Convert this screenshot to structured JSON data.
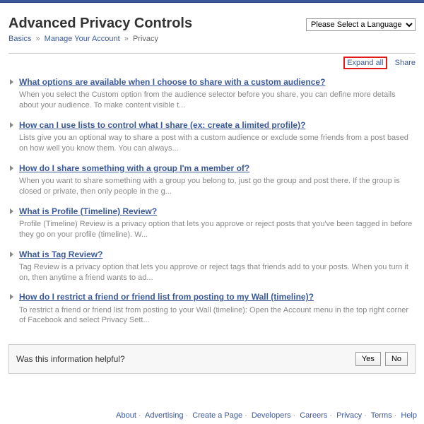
{
  "title": "Advanced Privacy Controls",
  "breadcrumb": {
    "basics": "Basics",
    "manage": "Manage Your Account",
    "current": "Privacy"
  },
  "lang_select": {
    "placeholder": "Please Select a Language"
  },
  "actions": {
    "expand_all": "Expand all",
    "share": "Share"
  },
  "faq": [
    {
      "q": "What options are available when I choose to share with a custom audience?",
      "a": "When you select the Custom option from the audience selector before you share, you can define more details about your audience. To make content visible t..."
    },
    {
      "q": "How can I use lists to control what I share (ex: create a limited profile)?",
      "a": "Lists give you an optional way to share a post with a custom audience or exclude some friends from a post based on how well you know them. You can always..."
    },
    {
      "q": "How do I share something with a group I'm a member of?",
      "a": "When you want to share something with a group you belong to, just go the group and post there. If the group is closed or private, then only people in the g..."
    },
    {
      "q": "What is Profile (Timeline) Review?",
      "a": "Profile (Timeline) Review is a privacy option that lets you approve or reject posts that you've been tagged in before they go on your profile (timeline). W..."
    },
    {
      "q": "What is Tag Review?",
      "a": "Tag Review is a privacy option that lets you approve or reject tags that friends add to your posts. When you turn it on, then anytime a friend wants to ad..."
    },
    {
      "q": "How do I restrict a friend or friend list from posting to my Wall (timeline)?",
      "a": "To restrict a friend or friend list from posting to your Wall (timeline): Open the Account menu in the top right corner of Facebook and select Privacy Sett..."
    }
  ],
  "feedback": {
    "question": "Was this information helpful?",
    "yes": "Yes",
    "no": "No"
  },
  "footer": {
    "about": "About",
    "advertising": "Advertising",
    "create": "Create a Page",
    "developers": "Developers",
    "careers": "Careers",
    "privacy": "Privacy",
    "terms": "Terms",
    "help": "Help"
  }
}
